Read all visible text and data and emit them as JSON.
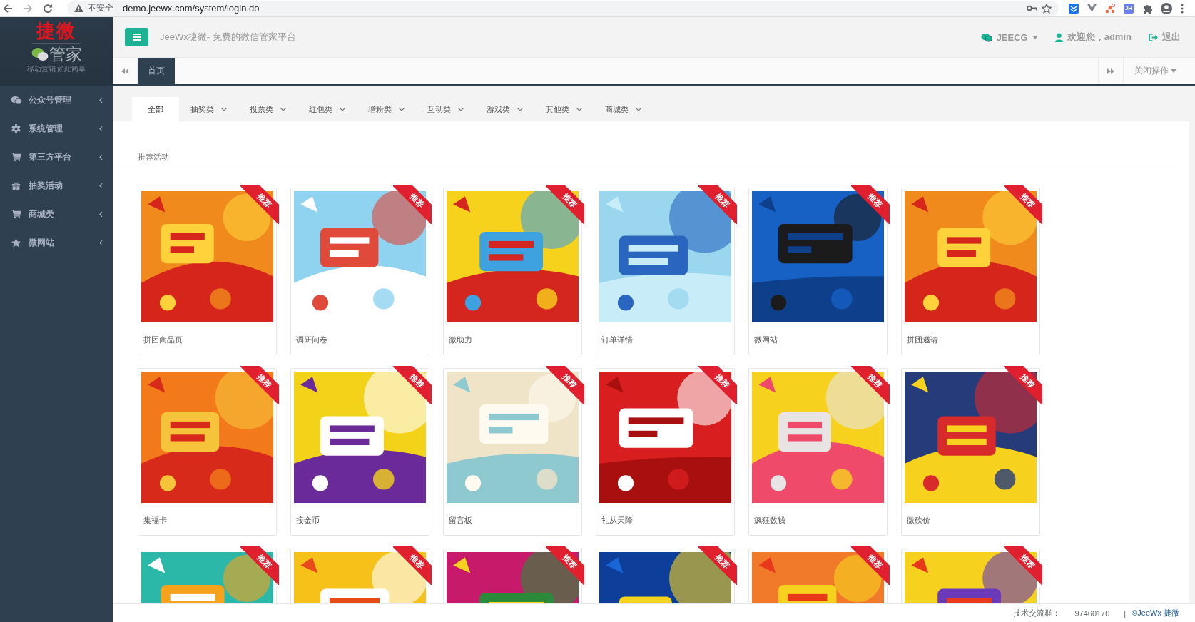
{
  "browser": {
    "security_label": "不安全",
    "url": "demo.jeewx.com/system/login.do",
    "extension_label": "JH"
  },
  "logo": {
    "title": "捷微",
    "subtitle": "管家",
    "tagline": "移动营销 如此简单"
  },
  "sidebar": {
    "items": [
      {
        "label": "公众号管理",
        "kind": "wechat"
      },
      {
        "label": "系统管理",
        "kind": "gear"
      },
      {
        "label": "第三方平台",
        "kind": "cart"
      },
      {
        "label": "抽奖活动",
        "kind": "gift"
      },
      {
        "label": "商城类",
        "kind": "cart"
      },
      {
        "label": "微网站",
        "kind": "star"
      }
    ]
  },
  "header": {
    "title": "JeeWx捷微- 免费的微信管家平台",
    "account": "JEECG",
    "greeting": "欢迎您，admin",
    "logout": "退出"
  },
  "page_tabs": {
    "tabs": [
      {
        "label": "首页",
        "selected": true
      }
    ],
    "close_menu": "关闭操作"
  },
  "categories": [
    {
      "label": "全部",
      "selected": true,
      "has_menu": false
    },
    {
      "label": "抽奖类",
      "selected": false,
      "has_menu": true
    },
    {
      "label": "投票类",
      "selected": false,
      "has_menu": true
    },
    {
      "label": "红包类",
      "selected": false,
      "has_menu": true
    },
    {
      "label": "增粉类",
      "selected": false,
      "has_menu": true
    },
    {
      "label": "互动类",
      "selected": false,
      "has_menu": true
    },
    {
      "label": "游戏类",
      "selected": false,
      "has_menu": true
    },
    {
      "label": "其他类",
      "selected": false,
      "has_menu": true
    },
    {
      "label": "商城类",
      "selected": false,
      "has_menu": true
    }
  ],
  "section_title": "推荐活动",
  "cards": [
    {
      "label": "拼团商品页",
      "badge": "推荐"
    },
    {
      "label": "调研问卷",
      "badge": "推荐"
    },
    {
      "label": "微助力",
      "badge": "推荐"
    },
    {
      "label": "订单详情",
      "badge": "推荐"
    },
    {
      "label": "微网站",
      "badge": "推荐"
    },
    {
      "label": "拼团邀请",
      "badge": "推荐"
    },
    {
      "label": "集福卡",
      "badge": "推荐"
    },
    {
      "label": "接金币",
      "badge": "推荐"
    },
    {
      "label": "留言板",
      "badge": "推荐"
    },
    {
      "label": "礼从天降",
      "badge": "推荐"
    },
    {
      "label": "疯狂数钱",
      "badge": "推荐"
    },
    {
      "label": "微砍价",
      "badge": "推荐"
    },
    {
      "badge": "推荐"
    },
    {
      "badge": "推荐"
    },
    {
      "badge": "推荐"
    },
    {
      "badge": "推荐"
    },
    {
      "badge": "推荐"
    },
    {
      "badge": "推荐"
    }
  ],
  "footer": {
    "group_label": "技术交流群：",
    "group_number": "97460170",
    "separator": "|",
    "copyright": "©JeeWx 捷微"
  }
}
